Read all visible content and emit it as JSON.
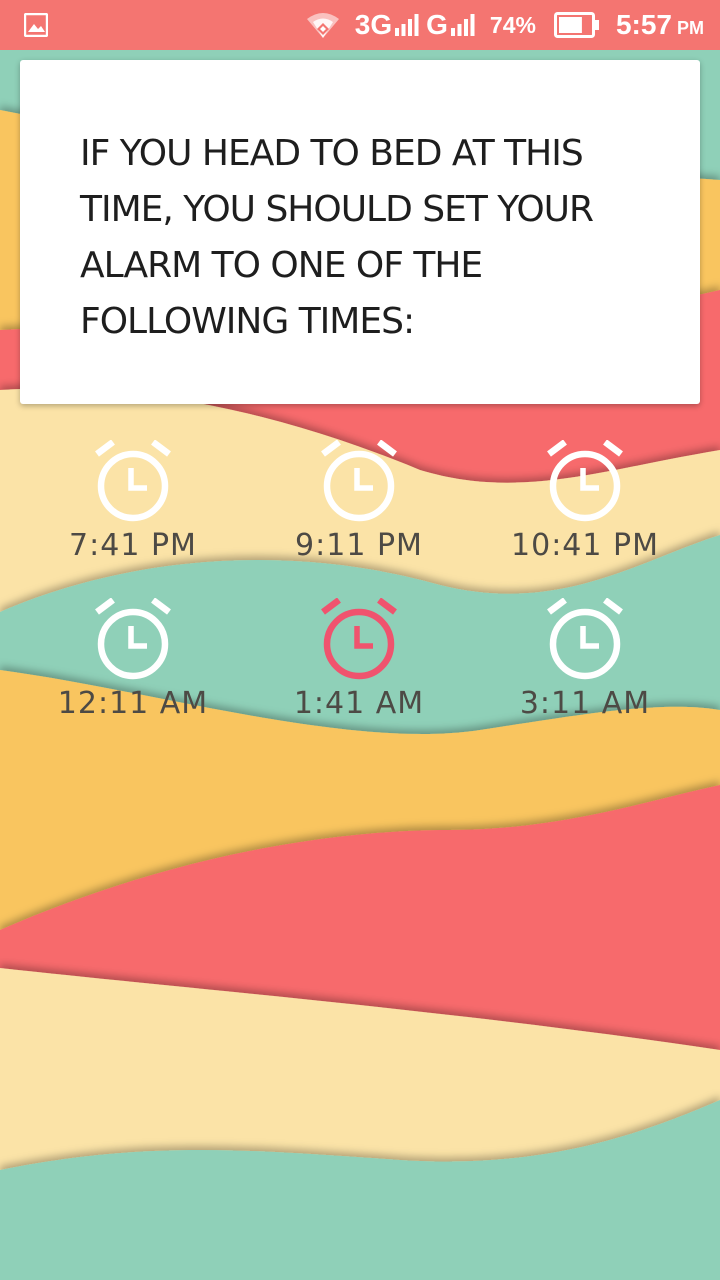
{
  "status_bar": {
    "network_1": "3G",
    "network_2": "G",
    "battery_percent": "74%",
    "battery_level": 0.74,
    "time": "5:57",
    "time_suffix": "PM",
    "icons": [
      "gallery-icon",
      "wifi-hotspot-icon",
      "signal-icon",
      "battery-icon"
    ]
  },
  "card": {
    "message": "IF YOU HEAD TO BED AT THIS TIME, YOU SHOULD SET YOUR ALARM TO ONE OF THE FOLLOWING TIMES:"
  },
  "alarms": [
    {
      "time": "7:41 PM",
      "highlighted": false
    },
    {
      "time": "9:11 PM",
      "highlighted": false
    },
    {
      "time": "10:41 PM",
      "highlighted": false
    },
    {
      "time": "12:11 AM",
      "highlighted": false
    },
    {
      "time": "1:41 AM",
      "highlighted": true
    },
    {
      "time": "3:11 AM",
      "highlighted": false
    }
  ],
  "colors": {
    "status_bar": "#f47571",
    "alarm_icon": "#ffffff",
    "alarm_icon_highlight": "#f0536e",
    "alarm_text": "#4d4a45",
    "card_background": "#ffffff",
    "card_text": "#1e1e1e",
    "wave_green": "#8fd0b8",
    "wave_yellow": "#f9c55f",
    "wave_red": "#f76a6c",
    "wave_cream": "#fbe3a7"
  }
}
